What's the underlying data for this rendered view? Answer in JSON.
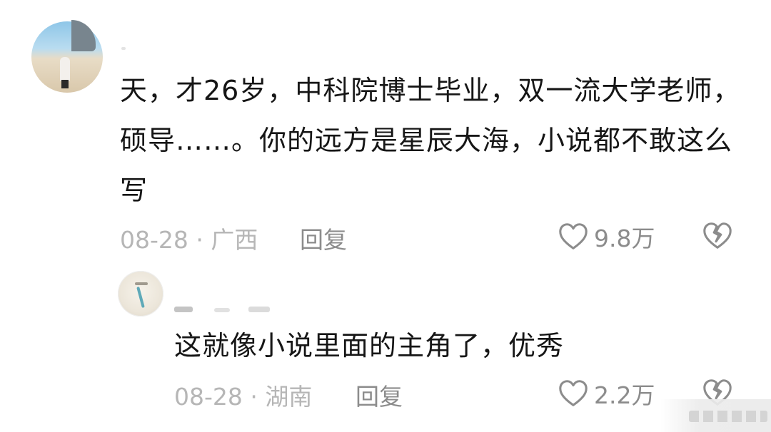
{
  "comments": [
    {
      "text": "天，才26岁，中科院博士毕业，双一流大学老师，硕导……。你的远方是星辰大海，小说都不敢这么写",
      "date": "08-28",
      "location": "广西",
      "reply_label": "回复",
      "like_count": "9.8万",
      "avatar_icon": "beach-photo-avatar"
    },
    {
      "text": "这就像小说里面的主角了，优秀",
      "date": "08-28",
      "location": "湖南",
      "reply_label": "回复",
      "like_count": "2.2万",
      "avatar_icon": "sketch-avatar"
    }
  ],
  "meta_separator": "·",
  "icons": {
    "like": "heart-outline-icon",
    "dislike": "broken-heart-icon"
  },
  "colors": {
    "text": "#161616",
    "meta": "#b6b6b6",
    "action": "#8c8c8c"
  }
}
